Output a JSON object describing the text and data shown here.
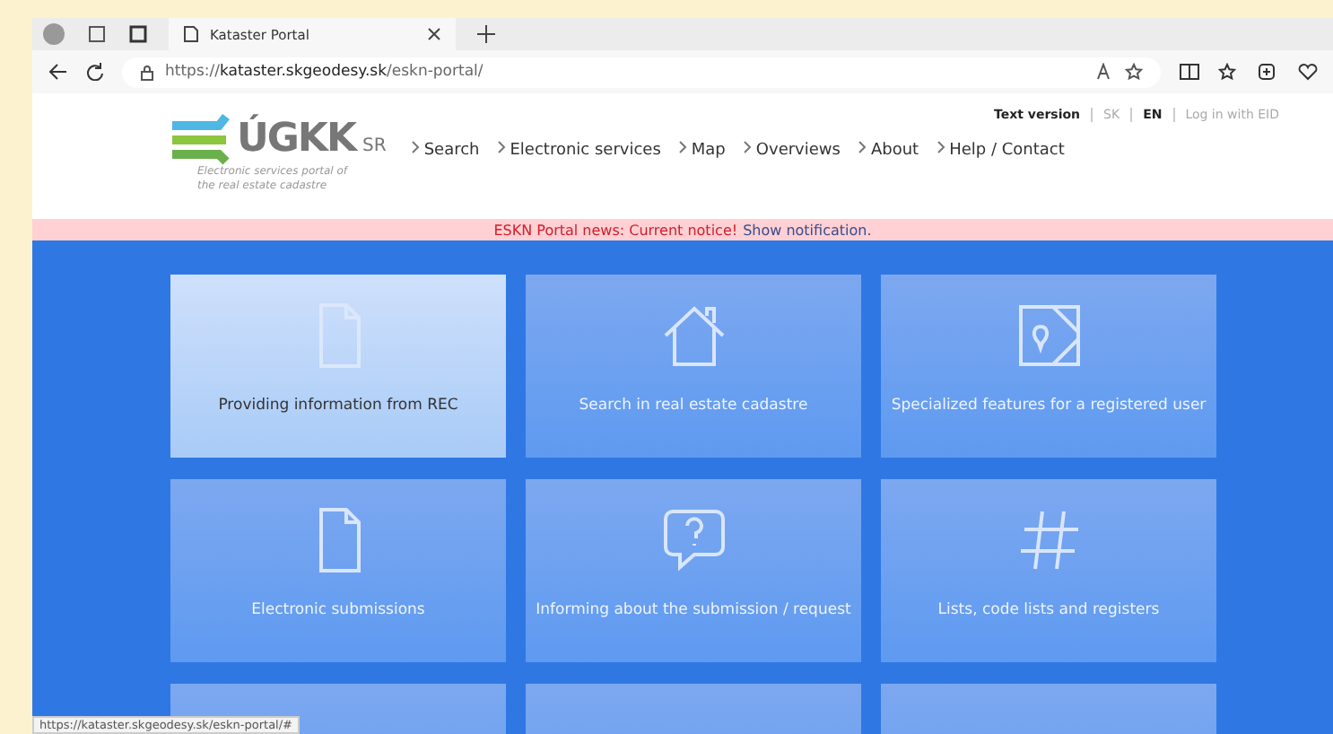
{
  "browser": {
    "tab_title": "Kataster Portal",
    "url_prefix": "https://",
    "url_host": "kataster.skgeodesy.sk",
    "url_path": "/eskn-portal/"
  },
  "header": {
    "logo_text": "ÚGKK",
    "logo_suffix": "SR",
    "tagline": "Electronic services portal of the real estate cadastre",
    "top_links": [
      {
        "label": "Text version",
        "kind": "text"
      },
      {
        "label": "SK",
        "kind": "lang",
        "selected": false
      },
      {
        "label": "EN",
        "kind": "lang",
        "selected": true
      },
      {
        "label": "Log in with EID",
        "kind": "login"
      }
    ],
    "nav": [
      "Search",
      "Electronic services",
      "Map",
      "Overviews",
      "About",
      "Help / Contact"
    ]
  },
  "notice": {
    "label": "ESKN Portal news: Current notice!",
    "link": "Show notification."
  },
  "tiles": [
    {
      "kind": "document",
      "label": "Providing information from REC",
      "selected": true
    },
    {
      "kind": "house",
      "label": "Search in real estate cadastre",
      "selected": false
    },
    {
      "kind": "map",
      "label": "Specialized features for a registered user",
      "selected": false
    },
    {
      "kind": "document",
      "label": "Electronic submissions",
      "selected": false
    },
    {
      "kind": "question",
      "label": "Informing about the submission / request",
      "selected": false
    },
    {
      "kind": "hash",
      "label": "Lists, code lists and registers",
      "selected": false
    },
    {
      "kind": "cut",
      "selected": false
    },
    {
      "kind": "cut",
      "selected": false
    },
    {
      "kind": "cut",
      "selected": false
    }
  ],
  "status_bar": "https://kataster.skgeodesy.sk/eskn-portal/#"
}
